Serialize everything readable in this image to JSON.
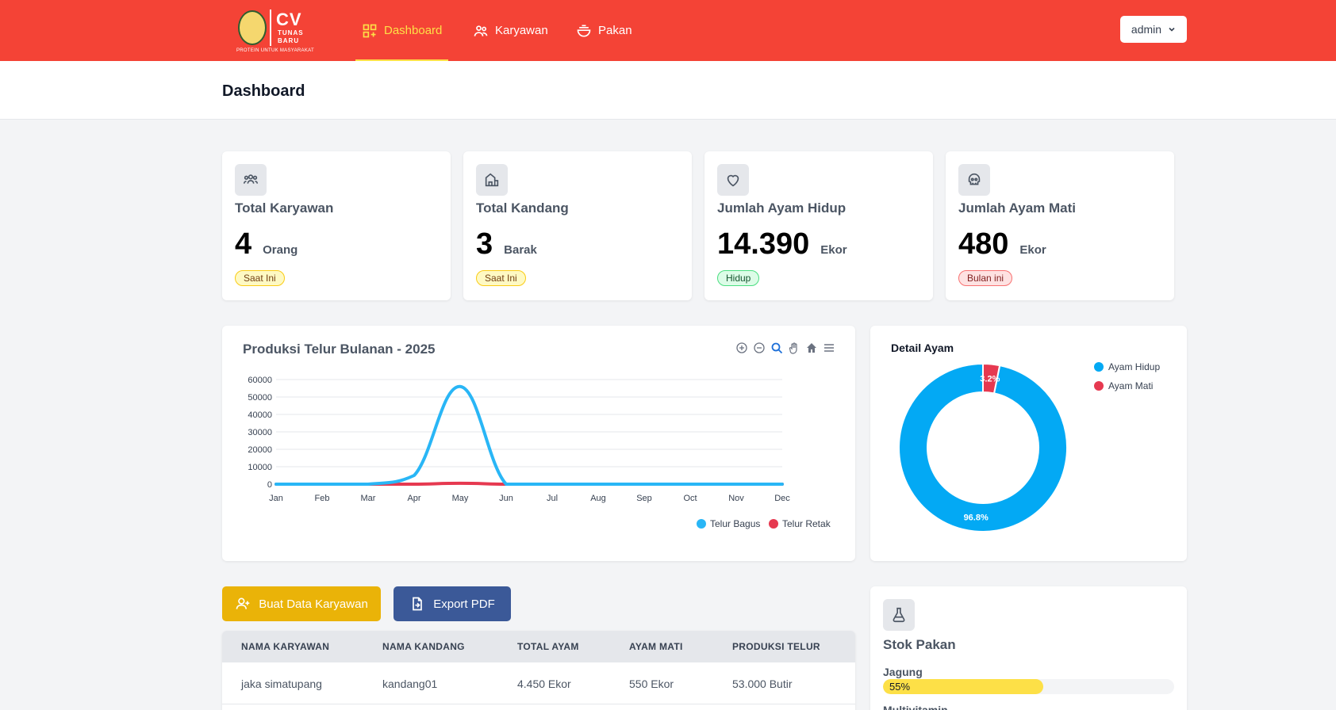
{
  "brand": {
    "logo_title": "CV",
    "logo_subtitle": "TUNAS BARU",
    "tagline": "PROTEIN UNTUK MASYARAKAT"
  },
  "nav": {
    "items": [
      {
        "label": "Dashboard",
        "icon": "dashboard-icon",
        "active": true
      },
      {
        "label": "Karyawan",
        "icon": "users-icon",
        "active": false
      },
      {
        "label": "Pakan",
        "icon": "bowl-icon",
        "active": false
      }
    ],
    "user_label": "admin"
  },
  "page": {
    "title": "Dashboard"
  },
  "stats": [
    {
      "label": "Total Karyawan",
      "value": "4",
      "unit": "Orang",
      "badge": "Saat Ini",
      "badge_color": "yellow",
      "icon": "users-icon"
    },
    {
      "label": "Total Kandang",
      "value": "3",
      "unit": "Barak",
      "badge": "Saat Ini",
      "badge_color": "yellow",
      "icon": "barn-icon"
    },
    {
      "label": "Jumlah Ayam Hidup",
      "value": "14.390",
      "unit": "Ekor",
      "badge": "Hidup",
      "badge_color": "green",
      "icon": "heart-icon"
    },
    {
      "label": "Jumlah Ayam Mati",
      "value": "480",
      "unit": "Ekor",
      "badge": "Bulan ini",
      "badge_color": "red",
      "icon": "skull-icon"
    }
  ],
  "chart_data": [
    {
      "type": "line",
      "title": "Produksi Telur Bulanan - 2025",
      "categories": [
        "Jan",
        "Feb",
        "Mar",
        "Apr",
        "May",
        "Jun",
        "Jul",
        "Aug",
        "Sep",
        "Oct",
        "Nov",
        "Dec"
      ],
      "series": [
        {
          "name": "Telur Bagus",
          "color": "#29b6f6",
          "values": [
            0,
            0,
            0,
            5000,
            56000,
            0,
            0,
            0,
            0,
            0,
            0,
            0
          ]
        },
        {
          "name": "Telur Retak",
          "color": "#e63950",
          "values": [
            0,
            0,
            0,
            0,
            500,
            0,
            0,
            0,
            0,
            0,
            0,
            0
          ]
        }
      ],
      "yticks": [
        "0",
        "10000",
        "20000",
        "30000",
        "40000",
        "50000",
        "60000"
      ],
      "ylim": [
        0,
        60000
      ],
      "grid": true,
      "legend": "bottom-right"
    },
    {
      "type": "pie",
      "title": "Detail Ayam",
      "donut": true,
      "slices": [
        {
          "name": "Ayam Hidup",
          "value": 96.8,
          "label": "96.8%",
          "color": "#03a9f4"
        },
        {
          "name": "Ayam Mati",
          "value": 3.2,
          "label": "3.2%",
          "color": "#e63950"
        }
      ],
      "legend": "top-right"
    }
  ],
  "buttons": {
    "create": "Buat Data Karyawan",
    "export": "Export PDF"
  },
  "table": {
    "headers": [
      "NAMA KARYAWAN",
      "NAMA KANDANG",
      "TOTAL AYAM",
      "AYAM MATI",
      "PRODUKSI TELUR"
    ],
    "rows": [
      [
        "jaka simatupang",
        "kandang01",
        "4.450 Ekor",
        "550 Ekor",
        "53.000 Butir"
      ]
    ]
  },
  "pakan": {
    "title": "Stok Pakan",
    "items": [
      {
        "label": "Jagung",
        "percent": 55,
        "percent_label": "55%"
      },
      {
        "label": "Multivitamin"
      }
    ]
  },
  "colors": {
    "topbar": "#f44336",
    "active_nav": "#fde047",
    "btn_create": "#eab308",
    "btn_export": "#3b5998"
  }
}
